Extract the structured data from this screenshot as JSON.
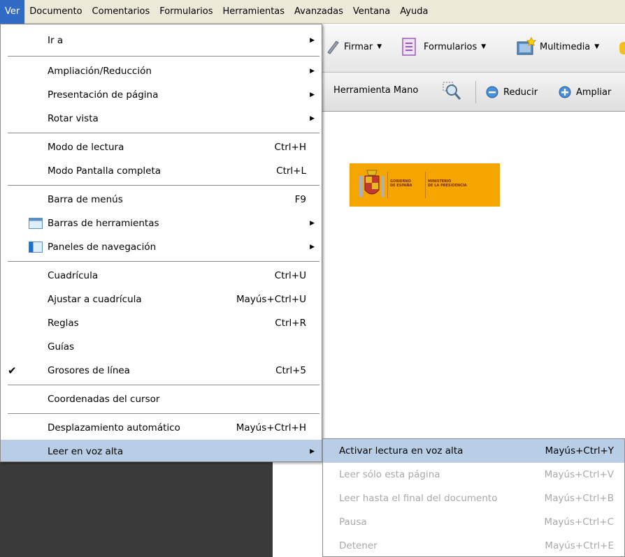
{
  "menubar": {
    "items": [
      "Ver",
      "Documento",
      "Comentarios",
      "Formularios",
      "Herramientas",
      "Avanzadas",
      "Ventana",
      "Ayuda"
    ],
    "active_index": 0
  },
  "toolbar1": {
    "firmar": "Firmar",
    "formularios": "Formularios",
    "multimedia": "Multimedia"
  },
  "toolbar2": {
    "hand_tool": "Herramienta Mano",
    "reducir": "Reducir",
    "ampliar": "Ampliar"
  },
  "document": {
    "logo_line1": "GOBIERNO",
    "logo_line2": "DE ESPAÑA",
    "logo_line3": "MINISTERIO",
    "logo_line4": "DE LA PRESIDENCIA"
  },
  "menu": {
    "items": [
      {
        "label": "Ir a",
        "shortcut": "",
        "submenu": true
      },
      {
        "label": "Ampliación/Reducción",
        "shortcut": "",
        "submenu": true
      },
      {
        "label": "Presentación de página",
        "shortcut": "",
        "submenu": true
      },
      {
        "label": "Rotar vista",
        "shortcut": "",
        "submenu": true
      },
      {
        "label": "Modo de lectura",
        "shortcut": "Ctrl+H"
      },
      {
        "label": "Modo Pantalla completa",
        "shortcut": "Ctrl+L"
      },
      {
        "label": "Barra de menús",
        "shortcut": "F9"
      },
      {
        "label": "Barras de herramientas",
        "shortcut": "",
        "submenu": true,
        "icon": "toolbars-icon"
      },
      {
        "label": "Paneles de navegación",
        "shortcut": "",
        "submenu": true,
        "icon": "navigation-panels-icon"
      },
      {
        "label": "Cuadrícula",
        "shortcut": "Ctrl+U"
      },
      {
        "label": "Ajustar a cuadrícula",
        "shortcut": "Mayús+Ctrl+U"
      },
      {
        "label": "Reglas",
        "shortcut": "Ctrl+R"
      },
      {
        "label": "Guías",
        "shortcut": ""
      },
      {
        "label": "Grosores de línea",
        "shortcut": "Ctrl+5",
        "checked": true
      },
      {
        "label": "Coordenadas del cursor",
        "shortcut": ""
      },
      {
        "label": "Desplazamiento automático",
        "shortcut": "Mayús+Ctrl+H"
      },
      {
        "label": "Leer en voz alta",
        "shortcut": "",
        "submenu": true,
        "highlighted": true
      }
    ]
  },
  "submenu": {
    "items": [
      {
        "label": "Activar lectura en voz alta",
        "shortcut": "Mayús+Ctrl+Y",
        "highlighted": true,
        "disabled": false
      },
      {
        "label": "Leer sólo esta página",
        "shortcut": "Mayús+Ctrl+V",
        "disabled": true
      },
      {
        "label": "Leer hasta el final del documento",
        "shortcut": "Mayús+Ctrl+B",
        "disabled": true
      },
      {
        "label": "Pausa",
        "shortcut": "Mayús+Ctrl+C",
        "disabled": true
      },
      {
        "label": "Detener",
        "shortcut": "Mayús+Ctrl+E",
        "disabled": true
      }
    ]
  },
  "colors": {
    "menubar_active": "#316ac5",
    "menu_highlight": "#b8cde6",
    "logo_background": "#f4a500",
    "nav_panel": "#3a3a3a"
  }
}
